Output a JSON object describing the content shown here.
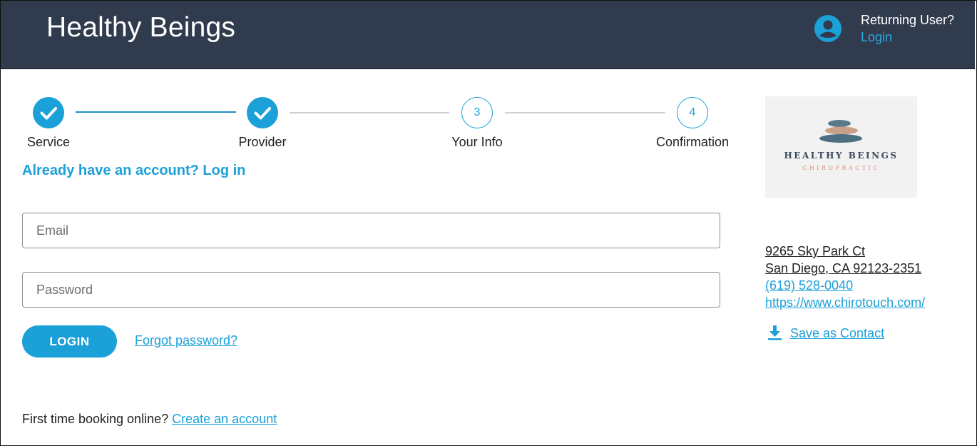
{
  "header": {
    "brand": "Healthy Beings",
    "returning_user": "Returning User?",
    "login_link": "Login"
  },
  "stepper": {
    "steps": [
      {
        "label": "Service",
        "number": "1",
        "status": "complete"
      },
      {
        "label": "Provider",
        "number": "2",
        "status": "complete"
      },
      {
        "label": "Your Info",
        "number": "3",
        "status": "pending"
      },
      {
        "label": "Confirmation",
        "number": "4",
        "status": "pending"
      }
    ]
  },
  "form": {
    "heading": "Already have an account? Log in",
    "email_placeholder": "Email",
    "password_placeholder": "Password",
    "login_button": "LOGIN",
    "forgot_link": "Forgot password?",
    "first_time_text": "First time booking online?",
    "create_account_link": "Create an account"
  },
  "sidebar": {
    "logo_title": "HEALTHY BEINGS",
    "logo_subtitle": "CHIROPRACTIC",
    "address_line1": "9265 Sky Park Ct",
    "address_line2": "San Diego, CA 92123-2351",
    "phone": "(619) 528-0040",
    "website": "https://www.chirotouch.com/",
    "save_contact": "Save as Contact"
  },
  "colors": {
    "header_bg": "#313b4e",
    "accent": "#1ba0d8",
    "link_light": "#29a8dc"
  }
}
